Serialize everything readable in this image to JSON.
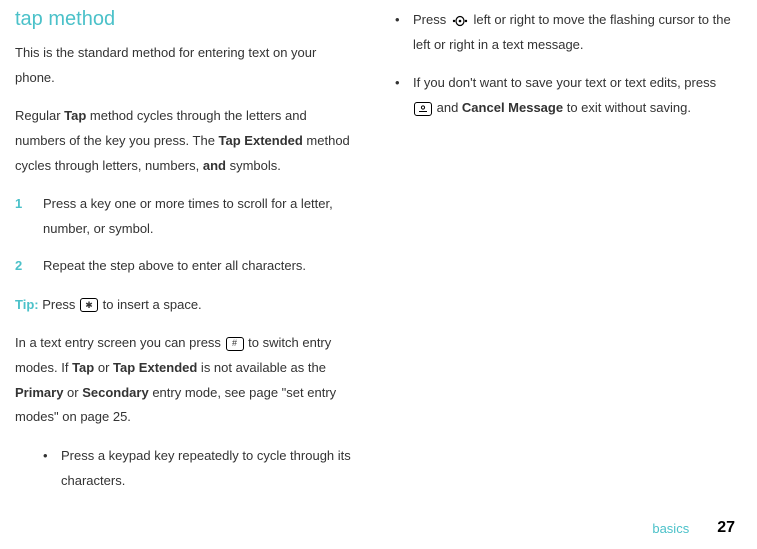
{
  "heading": "tap method",
  "col1": {
    "p1": "This is the standard method for entering text on your phone.",
    "p2a": "Regular ",
    "p2_tap": "Tap",
    "p2b": " method cycles through the letters and numbers of the key you press. The ",
    "p2_tapext": "Tap Extended",
    "p2c": " method cycles through letters, numbers, ",
    "p2_and": "and",
    "p2d": " symbols.",
    "step1_num": "1",
    "step1": "Press a key one or more times to scroll for a letter, number, or symbol.",
    "step2_num": "2",
    "step2": "Repeat the step above to enter all characters.",
    "tip_label": "Tip:",
    "tip_a": " Press ",
    "tip_b": " to insert a space.",
    "p3a": "In a text entry screen you can press ",
    "p3b": " to switch entry modes. If ",
    "p3_tap": "Tap",
    "p3c": " or ",
    "p3_tapext": "Tap Extended",
    "p3d": " is not available as the ",
    "p3_prim": "Primary",
    "p3e": " or ",
    "p3_sec": "Secondary",
    "p3f": " entry mode, see page \"set entry modes\" on page 25.",
    "b1": "Press a keypad key repeatedly to cycle through its characters."
  },
  "col2": {
    "b2a": "Press ",
    "b2b": " left or right to move the flashing cursor to the left or right in a text message.",
    "b3a": "If you don't want to save your text or text edits, press ",
    "b3b": " and ",
    "b3_cancel": "Cancel Message",
    "b3c": " to exit without saving."
  },
  "footer": {
    "label": "basics",
    "page": "27"
  },
  "icons": {
    "star": "✱",
    "hash": "#",
    "end": "☉"
  },
  "bullets": {
    "dot": "•"
  }
}
